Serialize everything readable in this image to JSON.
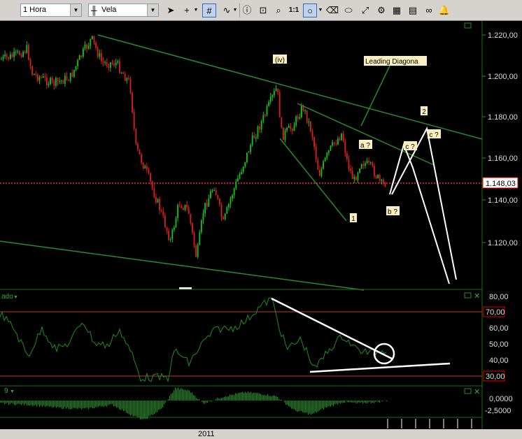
{
  "toolbar": {
    "timeframe": "1 Hora",
    "chart_type": "Vela",
    "zoom_reset": "1:1",
    "icons": [
      "pointer-icon",
      "crosshair-icon",
      "grid-icon",
      "indicator-icon",
      "info-icon",
      "zoom-box-icon",
      "zoom-icon",
      "circle-tool-icon",
      "eraser-icon",
      "ellipse-icon",
      "line-tool-icon",
      "fibonacci-icon",
      "object-list-icon",
      "template-icon",
      "link-icon",
      "alert-bell-icon"
    ]
  },
  "price_panel": {
    "current_price": "1.148,03",
    "axis_ticks": [
      "1.220,00",
      "1.200,00",
      "1.180,00",
      "1.160,00",
      "1.140,00",
      "1.120,00"
    ],
    "wave_labels": {
      "iv": "(iv)",
      "leading": "Leading Diagona",
      "w2": "2",
      "c_right": "c ?",
      "c_mid": "c ?",
      "a": "a ?",
      "b": "b ?",
      "w1": "1"
    }
  },
  "rsi_panel": {
    "title": "ado",
    "axis_ticks": [
      "80,00",
      "60,00",
      "50,00",
      "40,00"
    ],
    "upper_level": "70,00",
    "lower_level": "30,00"
  },
  "macd_panel": {
    "title": "9",
    "axis_ticks": [
      "0,0000",
      "-2,5000"
    ]
  },
  "time_axis": {
    "year": "2011"
  },
  "colors": {
    "bull": "#16c416",
    "bear": "#e01c1c",
    "trendline": "#2a8a2a",
    "label_bg": "#fdf0c0",
    "price_line": "#ff2a2a"
  }
}
